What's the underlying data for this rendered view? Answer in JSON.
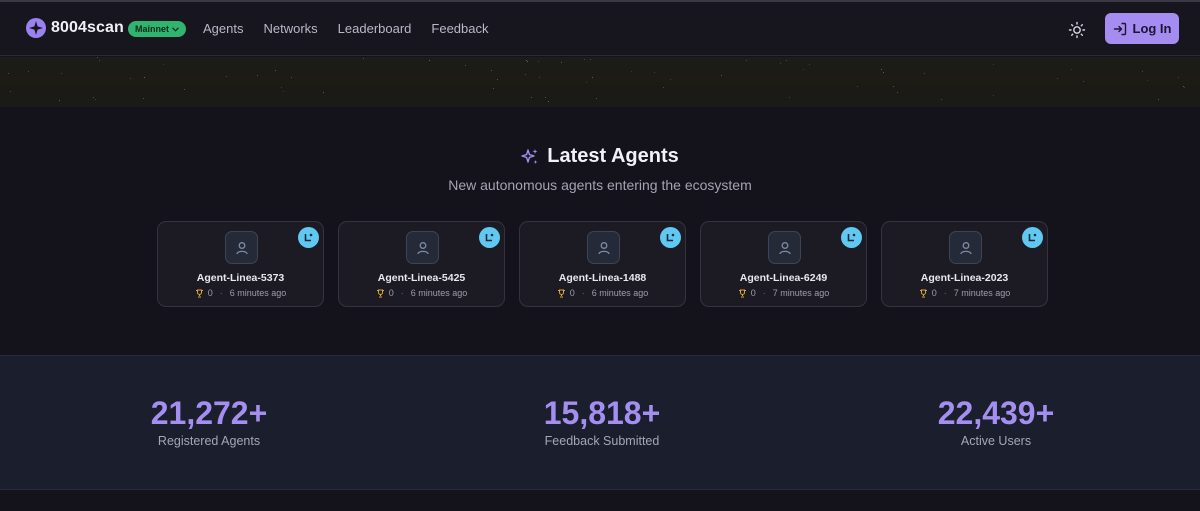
{
  "header": {
    "brand": "8004scan",
    "network_badge": "Mainnet",
    "nav": [
      "Agents",
      "Networks",
      "Leaderboard",
      "Feedback"
    ],
    "login_label": "Log In"
  },
  "latest": {
    "title": "Latest Agents",
    "subtitle": "New autonomous agents entering the ecosystem",
    "agents": [
      {
        "name": "Agent-Linea-5373",
        "score": "0",
        "time": "6 minutes ago"
      },
      {
        "name": "Agent-Linea-5425",
        "score": "0",
        "time": "6 minutes ago"
      },
      {
        "name": "Agent-Linea-1488",
        "score": "0",
        "time": "6 minutes ago"
      },
      {
        "name": "Agent-Linea-6249",
        "score": "0",
        "time": "7 minutes ago"
      },
      {
        "name": "Agent-Linea-2023",
        "score": "0",
        "time": "7 minutes ago"
      }
    ]
  },
  "stats": [
    {
      "value": "21,272+",
      "label": "Registered Agents"
    },
    {
      "value": "15,818+",
      "label": "Feedback Submitted"
    },
    {
      "value": "22,439+",
      "label": "Active Users"
    }
  ],
  "colors": {
    "accent": "#a58cf0",
    "badge_green": "#30b46e",
    "chain_badge": "#61c8f2",
    "trophy": "#e0a43a"
  },
  "icons": {
    "brand": "sparkle-logo-icon",
    "theme": "sun-icon",
    "login": "log-in-icon",
    "section": "sparkles-icon",
    "avatar": "user-icon",
    "chain": "linea-chain-icon",
    "score": "trophy-icon"
  }
}
